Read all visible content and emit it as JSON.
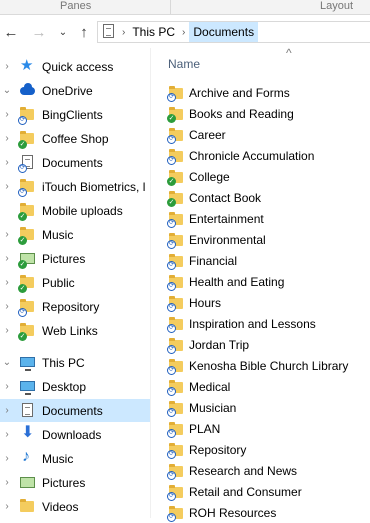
{
  "ribbon": {
    "left": "Panes",
    "right": "Layout"
  },
  "address": {
    "root": "This PC",
    "current": "Documents"
  },
  "columns": {
    "name": "Name"
  },
  "nav": [
    {
      "label": "Quick access",
      "icon": "star",
      "expander": "›",
      "selected": false
    },
    {
      "label": "OneDrive",
      "icon": "cloud",
      "expander": "⌄",
      "selected": false
    },
    {
      "label": "BingClients",
      "icon": "folder",
      "badge": "sync",
      "expander": "›",
      "selected": false
    },
    {
      "label": "Coffee Shop",
      "icon": "folder",
      "badge": "ok",
      "expander": "›",
      "selected": false
    },
    {
      "label": "Documents",
      "icon": "doc",
      "badge": "sync",
      "expander": "›",
      "selected": false
    },
    {
      "label": "iTouch Biometrics, l",
      "icon": "folder",
      "badge": "sync",
      "expander": "›",
      "selected": false
    },
    {
      "label": "Mobile uploads",
      "icon": "folder",
      "badge": "ok",
      "expander": "",
      "selected": false
    },
    {
      "label": "Music",
      "icon": "folder",
      "badge": "ok",
      "expander": "›",
      "selected": false
    },
    {
      "label": "Pictures",
      "icon": "pic",
      "badge": "ok",
      "expander": "›",
      "selected": false
    },
    {
      "label": "Public",
      "icon": "folder",
      "badge": "ok",
      "expander": "›",
      "selected": false
    },
    {
      "label": "Repository",
      "icon": "folder",
      "badge": "sync",
      "expander": "›",
      "selected": false
    },
    {
      "label": "Web Links",
      "icon": "folder",
      "badge": "ok",
      "expander": "›",
      "selected": false
    },
    {
      "label": "This PC",
      "icon": "monitor",
      "expander": "⌄",
      "selected": false
    },
    {
      "label": "Desktop",
      "icon": "monitor",
      "expander": "›",
      "selected": false
    },
    {
      "label": "Documents",
      "icon": "doc",
      "expander": "›",
      "selected": true
    },
    {
      "label": "Downloads",
      "icon": "download",
      "expander": "›",
      "selected": false
    },
    {
      "label": "Music",
      "icon": "note",
      "expander": "›",
      "selected": false
    },
    {
      "label": "Pictures",
      "icon": "pic",
      "expander": "›",
      "selected": false
    },
    {
      "label": "Videos",
      "icon": "folder",
      "expander": "›",
      "selected": false
    }
  ],
  "files": [
    {
      "label": "Archive and Forms",
      "badge": "sync"
    },
    {
      "label": "Books and Reading",
      "badge": "ok"
    },
    {
      "label": "Career",
      "badge": "sync"
    },
    {
      "label": "Chronicle Accumulation",
      "badge": "sync"
    },
    {
      "label": "College",
      "badge": "ok"
    },
    {
      "label": "Contact Book",
      "badge": "ok"
    },
    {
      "label": "Entertainment",
      "badge": "sync"
    },
    {
      "label": "Environmental",
      "badge": "sync"
    },
    {
      "label": "Financial",
      "badge": "sync"
    },
    {
      "label": "Health and Eating",
      "badge": "sync"
    },
    {
      "label": "Hours",
      "badge": "sync"
    },
    {
      "label": "Inspiration and Lessons",
      "badge": "sync"
    },
    {
      "label": "Jordan Trip",
      "badge": "sync"
    },
    {
      "label": "Kenosha Bible Church Library",
      "badge": "sync"
    },
    {
      "label": "Medical",
      "badge": "sync"
    },
    {
      "label": "Musician",
      "badge": "sync"
    },
    {
      "label": "PLAN",
      "badge": "sync"
    },
    {
      "label": "Repository",
      "badge": "sync"
    },
    {
      "label": "Research and News",
      "badge": "sync"
    },
    {
      "label": "Retail and Consumer",
      "badge": "sync"
    },
    {
      "label": "ROH Resources",
      "badge": "sync"
    }
  ]
}
